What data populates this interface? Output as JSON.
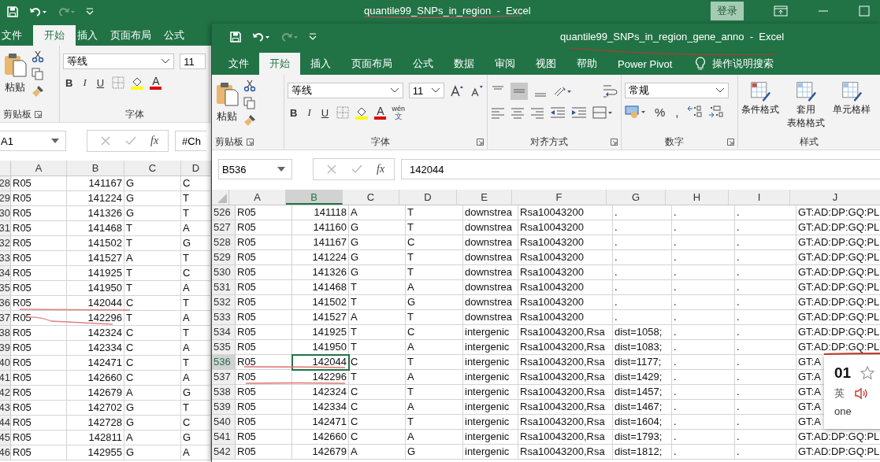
{
  "back_window": {
    "title": "quantile99_SNPs_in_region  -  Excel",
    "login_button": "登录",
    "tabs": [
      {
        "label": "文件",
        "selected": false
      },
      {
        "label": "开始",
        "selected": true
      },
      {
        "label": "插入",
        "selected": false
      },
      {
        "label": "页面布局",
        "selected": false
      },
      {
        "label": "公式",
        "selected": false
      }
    ],
    "ribbon": {
      "paste": "粘贴",
      "font_name": "等线",
      "font_size": "11",
      "format_buttons": [
        "B",
        "I",
        "U"
      ],
      "font_color": "A",
      "groups": [
        "剪贴板",
        "字体"
      ]
    },
    "name_box": "A1",
    "fx": "fx",
    "formula": "#Ch",
    "columns": [
      {
        "label": "A",
        "selected": false
      },
      {
        "label": "B",
        "selected": false
      },
      {
        "label": "C",
        "selected": false
      },
      {
        "label": "D",
        "selected": false
      }
    ],
    "rows": [
      {
        "header": "28",
        "selected": false,
        "cells": [
          "R05",
          "141167",
          "G",
          "C"
        ]
      },
      {
        "header": "29",
        "selected": false,
        "cells": [
          "R05",
          "141224",
          "G",
          "T"
        ]
      },
      {
        "header": "30",
        "selected": false,
        "cells": [
          "R05",
          "141326",
          "G",
          "T"
        ]
      },
      {
        "header": "31",
        "selected": false,
        "cells": [
          "R05",
          "141468",
          "T",
          "A"
        ]
      },
      {
        "header": "32",
        "selected": false,
        "cells": [
          "R05",
          "141502",
          "T",
          "G"
        ]
      },
      {
        "header": "33",
        "selected": false,
        "cells": [
          "R05",
          "141527",
          "A",
          "T"
        ]
      },
      {
        "header": "34",
        "selected": false,
        "cells": [
          "R05",
          "141925",
          "T",
          "C"
        ]
      },
      {
        "header": "35",
        "selected": false,
        "cells": [
          "R05",
          "141950",
          "T",
          "A"
        ]
      },
      {
        "header": "36",
        "selected": false,
        "cells": [
          "R05",
          "142044",
          "C",
          "T"
        ]
      },
      {
        "header": "37",
        "selected": false,
        "cells": [
          "R05",
          "142296",
          "T",
          "A"
        ]
      },
      {
        "header": "38",
        "selected": false,
        "cells": [
          "R05",
          "142324",
          "C",
          "T"
        ]
      },
      {
        "header": "39",
        "selected": false,
        "cells": [
          "R05",
          "142334",
          "C",
          "A"
        ]
      },
      {
        "header": "40",
        "selected": false,
        "cells": [
          "R05",
          "142471",
          "C",
          "T"
        ]
      },
      {
        "header": "41",
        "selected": false,
        "cells": [
          "R05",
          "142660",
          "C",
          "A"
        ]
      },
      {
        "header": "42",
        "selected": false,
        "cells": [
          "R05",
          "142679",
          "A",
          "G"
        ]
      },
      {
        "header": "43",
        "selected": false,
        "cells": [
          "R05",
          "142702",
          "G",
          "T"
        ]
      },
      {
        "header": "44",
        "selected": false,
        "cells": [
          "R05",
          "142728",
          "G",
          "C"
        ]
      },
      {
        "header": "45",
        "selected": false,
        "cells": [
          "R05",
          "142811",
          "A",
          "G"
        ]
      },
      {
        "header": "46",
        "selected": false,
        "cells": [
          "R05",
          "142955",
          "G",
          "A"
        ]
      }
    ]
  },
  "front_window": {
    "title": "quantile99_SNPs_in_region_gene_anno  -  Excel",
    "tabs": [
      {
        "label": "文件",
        "selected": false
      },
      {
        "label": "开始",
        "selected": true
      },
      {
        "label": "插入",
        "selected": false
      },
      {
        "label": "页面布局",
        "selected": false
      },
      {
        "label": "公式",
        "selected": false
      },
      {
        "label": "数据",
        "selected": false
      },
      {
        "label": "审阅",
        "selected": false
      },
      {
        "label": "视图",
        "selected": false
      },
      {
        "label": "帮助",
        "selected": false
      },
      {
        "label": "Power Pivot",
        "selected": false
      }
    ],
    "tell_me": "操作说明搜索",
    "ribbon": {
      "paste": "粘贴",
      "font_name": "等线",
      "font_size": "11",
      "format_buttons": [
        "B",
        "I",
        "U"
      ],
      "font_color": "A",
      "phonetic": "wén",
      "phonetic_char": "文",
      "number_format": "常规",
      "percent": "%",
      "comma": ",",
      "styles": [
        {
          "lines": [
            "条件格式"
          ]
        },
        {
          "lines": [
            "套用",
            "表格格式"
          ]
        },
        {
          "lines": [
            "单元格样"
          ]
        }
      ],
      "groups": [
        "剪贴板",
        "字体",
        "对齐方式",
        "数字",
        "样式"
      ]
    },
    "name_box": "B536",
    "fx": "fx",
    "formula": "142044",
    "columns": [
      {
        "label": "A",
        "selected": false
      },
      {
        "label": "B",
        "selected": true
      },
      {
        "label": "C",
        "selected": false
      },
      {
        "label": "D",
        "selected": false
      },
      {
        "label": "E",
        "selected": false
      },
      {
        "label": "F",
        "selected": false
      },
      {
        "label": "G",
        "selected": false
      },
      {
        "label": "H",
        "selected": false
      },
      {
        "label": "I",
        "selected": false
      },
      {
        "label": "J",
        "selected": false
      }
    ],
    "rows": [
      {
        "header": "526",
        "selected": false,
        "cells": [
          "R05",
          "141118",
          "A",
          "T",
          "downstrea",
          "Rsa10043200",
          ".",
          ".",
          ".",
          "GT:AD:DP:GQ:PL"
        ]
      },
      {
        "header": "527",
        "selected": false,
        "cells": [
          "R05",
          "141160",
          "G",
          "T",
          "downstrea",
          "Rsa10043200",
          ".",
          ".",
          ".",
          "GT:AD:DP:GQ:PL"
        ]
      },
      {
        "header": "528",
        "selected": false,
        "cells": [
          "R05",
          "141167",
          "G",
          "C",
          "downstrea",
          "Rsa10043200",
          ".",
          ".",
          ".",
          "GT:AD:DP:GQ:PL"
        ]
      },
      {
        "header": "529",
        "selected": false,
        "cells": [
          "R05",
          "141224",
          "G",
          "T",
          "downstrea",
          "Rsa10043200",
          ".",
          ".",
          ".",
          "GT:AD:DP:GQ:PL"
        ]
      },
      {
        "header": "530",
        "selected": false,
        "cells": [
          "R05",
          "141326",
          "G",
          "T",
          "downstrea",
          "Rsa10043200",
          ".",
          ".",
          ".",
          "GT:AD:DP:GQ:PL"
        ]
      },
      {
        "header": "531",
        "selected": false,
        "cells": [
          "R05",
          "141468",
          "T",
          "A",
          "downstrea",
          "Rsa10043200",
          ".",
          ".",
          ".",
          "GT:AD:DP:GQ:PL"
        ]
      },
      {
        "header": "532",
        "selected": false,
        "cells": [
          "R05",
          "141502",
          "T",
          "G",
          "downstrea",
          "Rsa10043200",
          ".",
          ".",
          ".",
          "GT:AD:DP:GQ:PL"
        ]
      },
      {
        "header": "533",
        "selected": false,
        "cells": [
          "R05",
          "141527",
          "A",
          "T",
          "downstrea",
          "Rsa10043200",
          ".",
          ".",
          ".",
          "GT:AD:DP:GQ:PL"
        ]
      },
      {
        "header": "534",
        "selected": false,
        "cells": [
          "R05",
          "141925",
          "T",
          "C",
          "intergenic",
          "Rsa10043200,Rsa",
          "dist=1058;",
          ".",
          ".",
          "GT:AD:DP:GQ:PL"
        ]
      },
      {
        "header": "535",
        "selected": false,
        "cells": [
          "R05",
          "141950",
          "T",
          "A",
          "intergenic",
          "Rsa10043200,Rsa",
          "dist=1083;",
          ".",
          ".",
          "GT:AD:DP:GQ:PL"
        ]
      },
      {
        "header": "536",
        "selected": true,
        "cells": [
          "R05",
          "142044",
          "C",
          "T",
          "intergenic",
          "Rsa10043200,Rsa",
          "dist=1177;",
          ".",
          ".",
          "GT:A"
        ]
      },
      {
        "header": "537",
        "selected": false,
        "cells": [
          "R05",
          "142296",
          "T",
          "A",
          "intergenic",
          "Rsa10043200,Rsa",
          "dist=1429;",
          ".",
          ".",
          "GT:A"
        ]
      },
      {
        "header": "538",
        "selected": false,
        "cells": [
          "R05",
          "142324",
          "C",
          "T",
          "intergenic",
          "Rsa10043200,Rsa",
          "dist=1457;",
          ".",
          ".",
          "GT:A"
        ]
      },
      {
        "header": "539",
        "selected": false,
        "cells": [
          "R05",
          "142334",
          "C",
          "A",
          "intergenic",
          "Rsa10043200,Rsa",
          "dist=1467;",
          ".",
          ".",
          "GT:A"
        ]
      },
      {
        "header": "540",
        "selected": false,
        "cells": [
          "R05",
          "142471",
          "C",
          "T",
          "intergenic",
          "Rsa10043200,Rsa",
          "dist=1604;",
          ".",
          ".",
          "GT:A"
        ]
      },
      {
        "header": "541",
        "selected": false,
        "cells": [
          "R05",
          "142660",
          "C",
          "A",
          "intergenic",
          "Rsa10043200,Rsa",
          "dist=1793;",
          ".",
          ".",
          "GT:AD:DP:GQ:PL"
        ]
      },
      {
        "header": "542",
        "selected": false,
        "cells": [
          "R05",
          "142679",
          "A",
          "G",
          "intergenic",
          "Rsa10043200,Rsa",
          "dist=1812;",
          ".",
          ".",
          "GT:AD:DP:GQ:PL"
        ]
      }
    ]
  },
  "dictionary_popup": {
    "word": "01",
    "language": "英",
    "meaning": "one"
  }
}
